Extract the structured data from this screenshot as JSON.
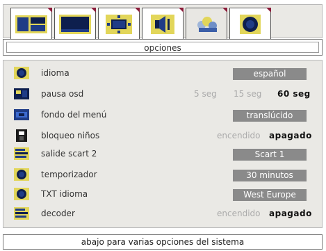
{
  "tabs": [
    {
      "icon": "general-settings-icon",
      "active": false
    },
    {
      "icon": "picture-icon",
      "active": false
    },
    {
      "icon": "screen-format-icon",
      "active": false
    },
    {
      "icon": "sound-icon",
      "active": false
    },
    {
      "icon": "options-icon",
      "active": true
    },
    {
      "icon": "channel-icon",
      "active": false
    }
  ],
  "header": {
    "title": "opciones"
  },
  "menu": [
    {
      "icon": "language-icon",
      "label": "idioma",
      "type": "box",
      "value": "español"
    },
    {
      "icon": "osd-pause-icon",
      "label": "pausa osd",
      "type": "options",
      "options": [
        {
          "text": "5 seg",
          "selected": false
        },
        {
          "text": "15 seg",
          "selected": false
        },
        {
          "text": "60 seg",
          "selected": true
        }
      ]
    },
    {
      "icon": "menu-background-icon",
      "label": "fondo del menú",
      "type": "box",
      "value": "translúcido"
    },
    {
      "icon": "child-lock-icon",
      "label": "bloqueo niños",
      "type": "options",
      "options": [
        {
          "text": "encendido",
          "selected": false
        },
        {
          "text": "apagado",
          "selected": true
        }
      ]
    },
    {
      "icon": "scart-output-icon",
      "label": "salide scart 2",
      "type": "box",
      "value": "Scart 1"
    },
    {
      "icon": "timer-icon",
      "label": "temporizador",
      "type": "box",
      "value": "30 minutos"
    },
    {
      "icon": "teletext-language-icon",
      "label": "TXT idioma",
      "type": "box",
      "value": "West Europe"
    },
    {
      "icon": "decoder-icon",
      "label": "decoder",
      "type": "options",
      "options": [
        {
          "text": "encendido",
          "selected": false
        },
        {
          "text": "apagado",
          "selected": true
        }
      ]
    }
  ],
  "footer": {
    "hint": "abajo para varias opciones del sistema"
  },
  "colors": {
    "accent": "#8a1c3a",
    "panel": "#eae9e5",
    "value_box": "#8a8a8a",
    "icon_blue": "#1f3c86",
    "icon_yellow": "#e2d65a"
  }
}
